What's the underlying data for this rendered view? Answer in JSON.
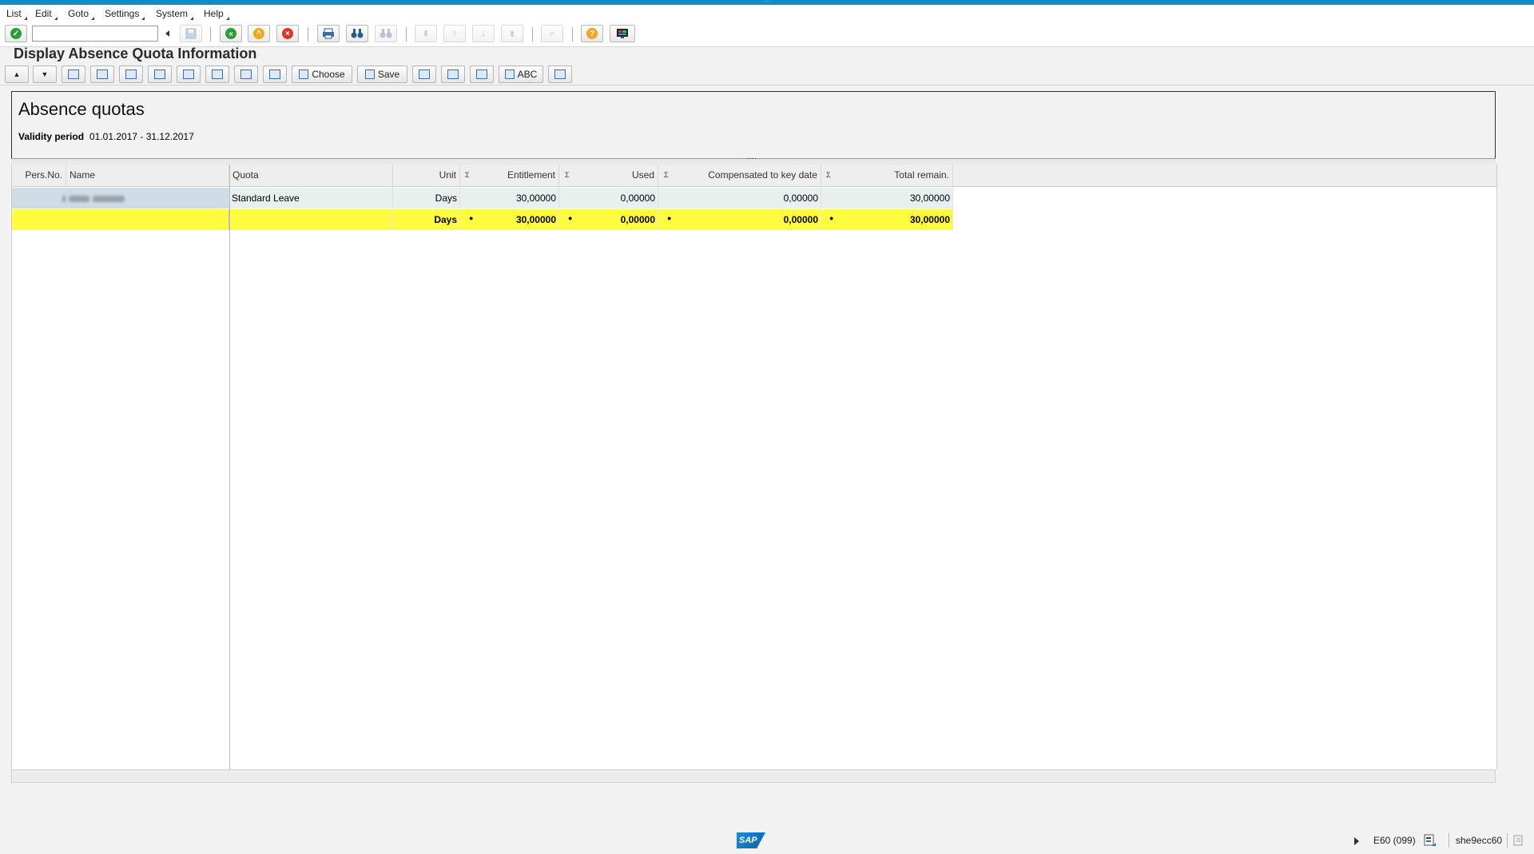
{
  "menu": [
    "List",
    "Edit",
    "Goto",
    "Settings",
    "System",
    "Help"
  ],
  "command_field": {
    "value": "",
    "placeholder": ""
  },
  "title": "Display Absence Quota Information",
  "toolbar2": {
    "choose_label": "Choose",
    "save_label": "Save",
    "abc_label": "ABC"
  },
  "header": {
    "heading": "Absence quotas",
    "validity_label": "Validity period",
    "validity_value": "01.01.2017 - 31.12.2017"
  },
  "grid": {
    "columns": {
      "pers_no": "Pers.No.",
      "name": "Name",
      "quota": "Quota",
      "unit": "Unit",
      "entitlement": "Entitlement",
      "used": "Used",
      "compensated": "Compensated to key date",
      "total_remain": "Total remain."
    },
    "row": {
      "quota": "Standard Leave",
      "unit": "Days",
      "entitlement": "30,00000",
      "used": "0,00000",
      "compensated": "0,00000",
      "total_remain": "30,00000"
    },
    "total": {
      "unit": "Days",
      "entitlement": "30,00000",
      "used": "0,00000",
      "compensated": "0,00000",
      "total_remain": "30,00000"
    }
  },
  "status": {
    "system": "E60 (099)",
    "server": "she9ecc60",
    "logo": "SAP"
  },
  "colors": {
    "accent": "#0a8ecf",
    "total_row": "#fffb3f",
    "selected_row": "#cfdbe5"
  }
}
